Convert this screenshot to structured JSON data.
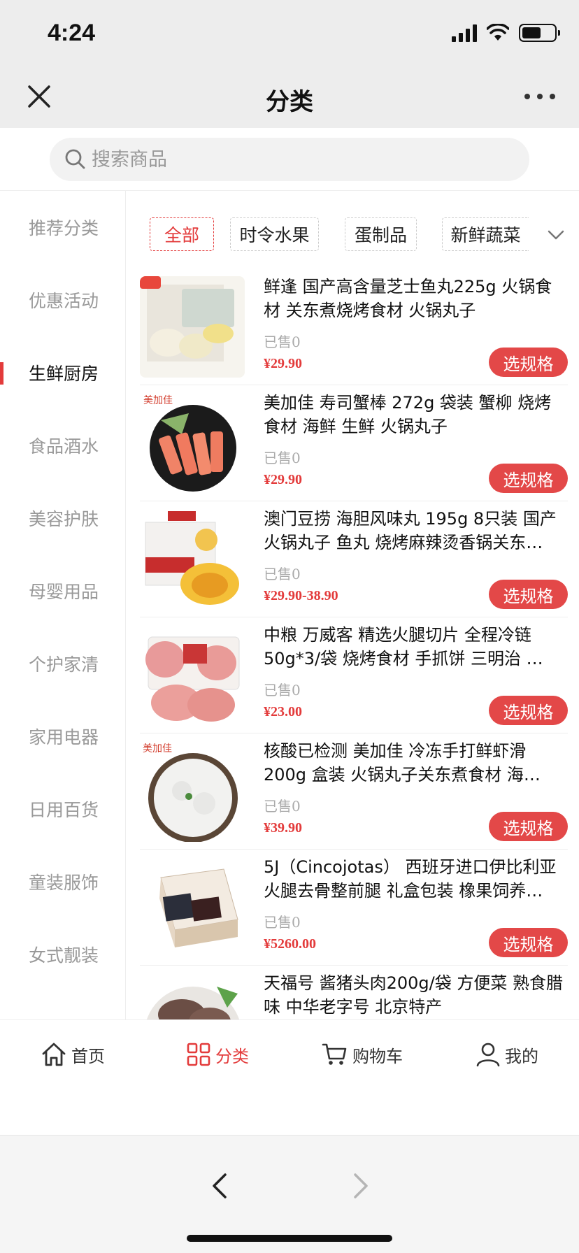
{
  "status_bar": {
    "time": "4:24",
    "battery_level": 0.6
  },
  "header": {
    "title": "分类"
  },
  "search": {
    "placeholder": "搜索商品"
  },
  "sidebar": {
    "items": [
      {
        "label": "推荐分类",
        "active": false
      },
      {
        "label": "优惠活动",
        "active": false
      },
      {
        "label": "生鲜厨房",
        "active": true
      },
      {
        "label": "食品酒水",
        "active": false
      },
      {
        "label": "美容护肤",
        "active": false
      },
      {
        "label": "母婴用品",
        "active": false
      },
      {
        "label": "个护家清",
        "active": false
      },
      {
        "label": "家用电器",
        "active": false
      },
      {
        "label": "日用百货",
        "active": false
      },
      {
        "label": "童装服饰",
        "active": false
      },
      {
        "label": "女式靓装",
        "active": false
      }
    ]
  },
  "filter_tabs": [
    {
      "label": "全部",
      "active": true
    },
    {
      "label": "时令水果",
      "active": false
    },
    {
      "label": "蛋制品",
      "active": false
    },
    {
      "label": "新鲜蔬菜",
      "active": false
    }
  ],
  "products": [
    {
      "title": "鲜逢 国产高含量芝士鱼丸225g 火锅食材 关东煮烧烤食材 火锅丸子",
      "sold": "已售0",
      "price": "¥29.90",
      "button": "选规格",
      "image": "cheese-fishball"
    },
    {
      "title": "美加佳 寿司蟹棒 272g 袋装 蟹柳 烧烤食材 海鲜 生鲜 火锅丸子",
      "sold": "已售0",
      "price": "¥29.90",
      "button": "选规格",
      "image": "crab-stick"
    },
    {
      "title": "澳门豆捞 海胆风味丸 195g 8只装 国产火锅丸子 鱼丸 烧烤麻辣烫香锅关东…",
      "sold": "已售0",
      "price": "¥29.90-38.90",
      "button": "选规格",
      "image": "sea-urchin-ball"
    },
    {
      "title": "中粮 万威客 精选火腿切片 全程冷链50g*3/袋 烧烤食材 手抓饼 三明治 …",
      "sold": "已售0",
      "price": "¥23.00",
      "button": "选规格",
      "image": "ham-slices"
    },
    {
      "title": "核酸已检测 美加佳 冷冻手打鲜虾滑 200g 盒装 火锅丸子关东煮食材 海…",
      "sold": "已售0",
      "price": "¥39.90",
      "button": "选规格",
      "image": "shrimp-paste"
    },
    {
      "title": "5J（Cincojotas） 西班牙进口伊比利亚火腿去骨整前腿 礼盒包装 橡果饲养…",
      "sold": "已售0",
      "price": "¥5260.00",
      "button": "选规格",
      "image": "iberico-ham-box"
    },
    {
      "title": "天福号 酱猪头肉200g/袋 方便菜 熟食腊味 中华老字号 北京特产",
      "sold": "",
      "price": "",
      "button": "",
      "image": "braised-pork"
    }
  ],
  "tabbar": {
    "items": [
      {
        "label": "首页",
        "icon": "home-icon",
        "active": false
      },
      {
        "label": "分类",
        "icon": "grid-icon",
        "active": true
      },
      {
        "label": "购物车",
        "icon": "cart-icon",
        "active": false
      },
      {
        "label": "我的",
        "icon": "user-icon",
        "active": false
      }
    ]
  },
  "colors": {
    "accent": "#e33b3b",
    "button_bg": "#e34848",
    "header_bg": "#ededed"
  }
}
